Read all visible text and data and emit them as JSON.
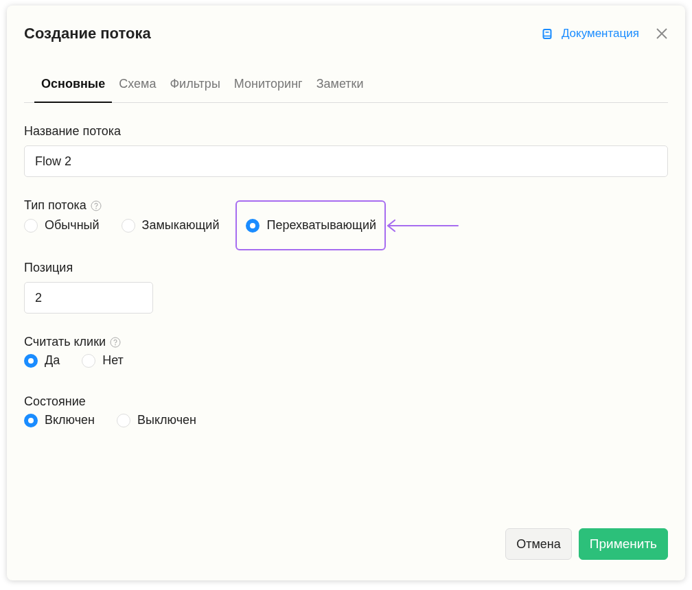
{
  "dialog": {
    "title": "Создание потока",
    "docs_link": "Документация"
  },
  "tabs": [
    {
      "label": "Основные",
      "selected": true
    },
    {
      "label": "Схема",
      "selected": false
    },
    {
      "label": "Фильтры",
      "selected": false
    },
    {
      "label": "Мониторинг",
      "selected": false
    },
    {
      "label": "Заметки",
      "selected": false
    }
  ],
  "fields": [
    {
      "kind": "text",
      "label": "Название потока",
      "value": "Flow 2",
      "help": false
    },
    {
      "kind": "radio",
      "label": "Тип потока",
      "help": true,
      "options": [
        {
          "label": "Обычный",
          "selected": false,
          "highlighted": false
        },
        {
          "label": "Замыкающий",
          "selected": false,
          "highlighted": false
        },
        {
          "label": "Перехватывающий",
          "selected": true,
          "highlighted": true
        }
      ]
    },
    {
      "kind": "number",
      "label": "Позиция",
      "value": "2",
      "help": false
    },
    {
      "kind": "radio",
      "label": "Считать клики",
      "help": true,
      "options": [
        {
          "label": "Да",
          "selected": true,
          "highlighted": false
        },
        {
          "label": "Нет",
          "selected": false,
          "highlighted": false
        }
      ]
    },
    {
      "kind": "radio",
      "label": "Состояние",
      "help": false,
      "options": [
        {
          "label": "Включен",
          "selected": true,
          "highlighted": false
        },
        {
          "label": "Выключен",
          "selected": false,
          "highlighted": false
        }
      ]
    }
  ],
  "buttons": [
    {
      "label": "Отмена",
      "kind": "secondary"
    },
    {
      "label": "Применить",
      "kind": "primary"
    }
  ]
}
